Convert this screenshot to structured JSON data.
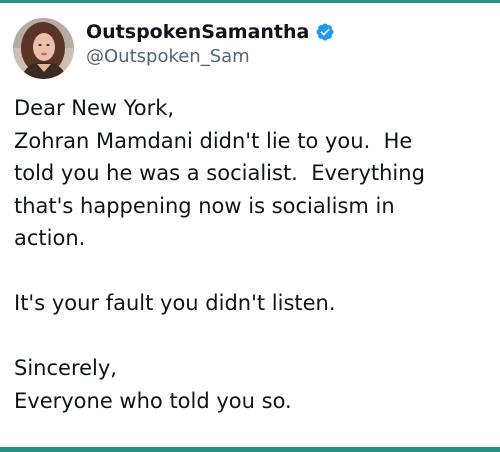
{
  "post": {
    "author": {
      "display_name": "OutspokenSamantha",
      "handle": "@Outspoken_Sam",
      "verified_icon": "verified-badge-icon",
      "avatar_icon": "profile-photo"
    },
    "paragraphs": [
      {
        "lines": [
          "Dear New York,",
          "Zohran Mamdani didn't lie to you.  He",
          "told you he was a socialist.  Everything",
          "that's happening now is socialism in",
          "action."
        ]
      },
      {
        "lines": [
          "It's your fault you didn't listen."
        ]
      },
      {
        "lines": [
          "Sincerely,",
          "Everyone who told you so."
        ]
      }
    ]
  },
  "colors": {
    "accent_bar": "#2a8f86",
    "verified": "#1d9bf0",
    "text": "#0f1419",
    "handle": "#536471"
  }
}
